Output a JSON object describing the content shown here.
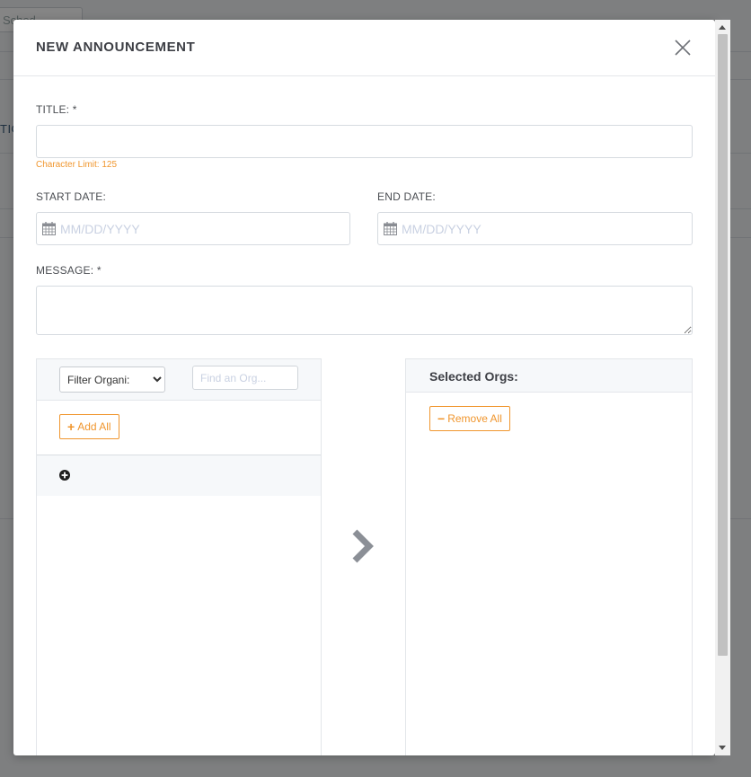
{
  "background": {
    "top_button_label": "Sched",
    "side_text": "TIC"
  },
  "modal": {
    "title": "NEW ANNOUNCEMENT",
    "close_icon": "close-icon"
  },
  "form": {
    "title_label": "TITLE: *",
    "title_value": "",
    "title_hint": "Character Limit: 125",
    "start_date_label": "START DATE:",
    "start_date_placeholder": "MM/DD/YYYY",
    "end_date_label": "END DATE:",
    "end_date_placeholder": "MM/DD/YYYY",
    "message_label": "MESSAGE: *",
    "message_value": ""
  },
  "orgs": {
    "filter_selected": "Filter Organi:",
    "find_placeholder": "Find an Org...",
    "add_all_label": "Add All",
    "selected_header": "Selected Orgs:",
    "remove_all_label": "Remove All",
    "move_icon": "chevron-right-icon"
  },
  "colors": {
    "accent": "#f0962e",
    "placeholder": "#c9d1e2",
    "panel_header_bg": "#f6f8fa"
  }
}
